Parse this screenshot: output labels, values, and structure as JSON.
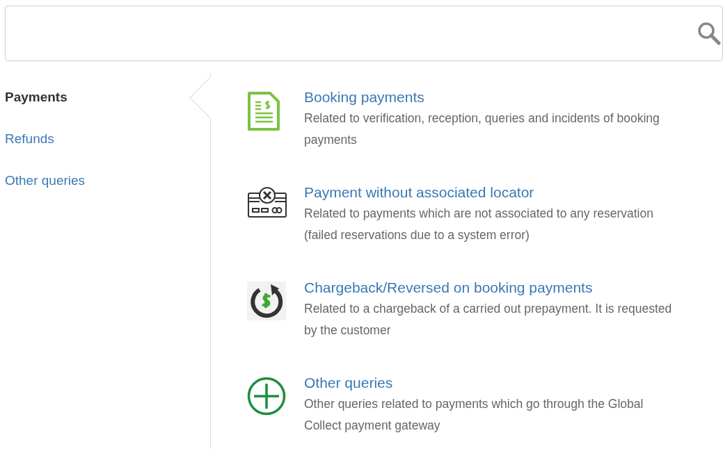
{
  "sidebar": {
    "items": [
      {
        "label": "Payments",
        "selected": true
      },
      {
        "label": "Refunds",
        "selected": false
      },
      {
        "label": "Other queries",
        "selected": false
      }
    ]
  },
  "topics": [
    {
      "kind": "document",
      "title": "Booking payments",
      "description": "Related to verification, reception, queries and incidents of booking payments"
    },
    {
      "kind": "card",
      "title": "Payment without associated locator",
      "description": "Related to payments which are not associated to any reservation (failed reservations due to a system error)"
    },
    {
      "kind": "refund",
      "title": "Chargeback/Reversed on booking payments",
      "description": "Related to a chargeback of a carried out prepayment. It is requested by the customer"
    },
    {
      "kind": "plus",
      "title": "Other queries",
      "description": "Other queries related to payments which go through the Global Collect payment gateway"
    }
  ]
}
